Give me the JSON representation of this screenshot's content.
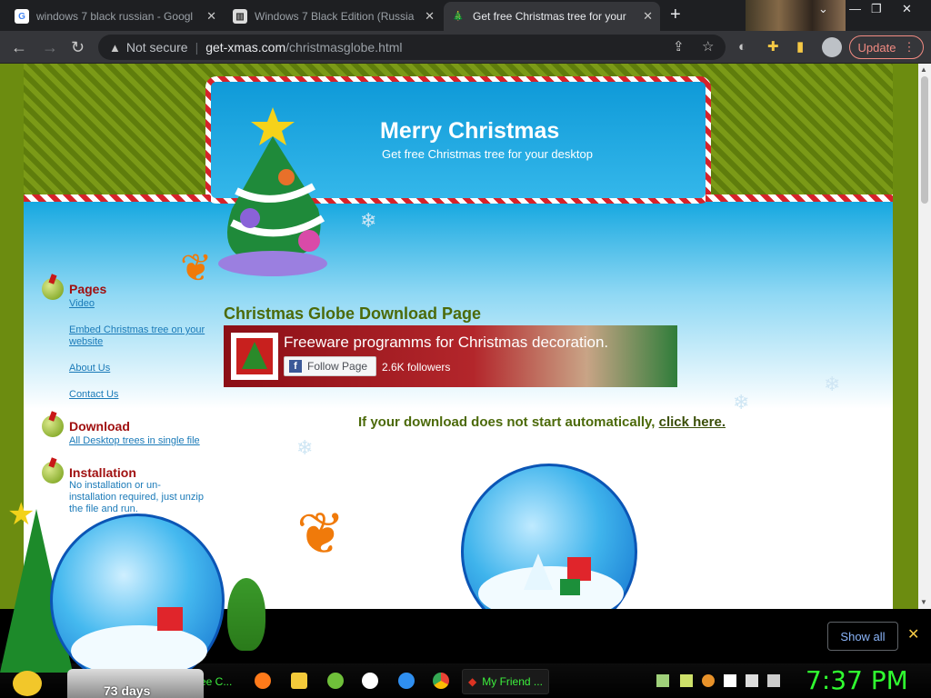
{
  "browser": {
    "tabs": [
      {
        "title": "windows 7 black russian - Googl",
        "favicon": "google-icon"
      },
      {
        "title": "Windows 7 Black Edition (Russia",
        "favicon": "bank-icon"
      },
      {
        "title": "Get free Christmas tree for your",
        "favicon": "tree-icon",
        "active": true
      }
    ],
    "close_glyph": "✕",
    "new_tab_glyph": "+",
    "window_controls": [
      "⌄",
      "—",
      "❐",
      "✕"
    ],
    "security_label": "Not secure",
    "url_host": "get-xmas.com",
    "url_path": "/christmasglobe.html",
    "update_label": "Update",
    "menu_glyph": "⋮"
  },
  "site": {
    "title": "Merry Christmas",
    "subtitle": "Get free Christmas tree for your desktop",
    "sidebar": {
      "pages_title": "Pages",
      "pages_links": [
        "Video",
        "Embed Christmas tree on your website",
        "About Us",
        "Contact Us"
      ],
      "download_title": "Download",
      "download_links": [
        "All Desktop trees in single file"
      ],
      "install_title": "Installation",
      "install_text": "No installation or un-installation required, just unzip the file and run."
    },
    "page_heading": "Christmas Globe Download Page",
    "fb_widget": {
      "title": "Freeware programms for Christmas decoration.",
      "follow_label": "Follow Page",
      "followers": "2.6K followers"
    },
    "download_message": "If your download does not start automatically,",
    "download_link": "click here."
  },
  "shelf": {
    "show_all_label": "Show all",
    "close_glyph": "✕"
  },
  "taskbar": {
    "left_task_label": "ee C...",
    "friend_task_label": "My Friend ...",
    "clock": "7:37 PM",
    "gadget_days": "73 days"
  },
  "colors": {
    "accent_green": "#4c6a0a",
    "sidebar_title": "#a01010",
    "link_blue": "#1a7ab8",
    "clock_green": "#30ff30"
  }
}
